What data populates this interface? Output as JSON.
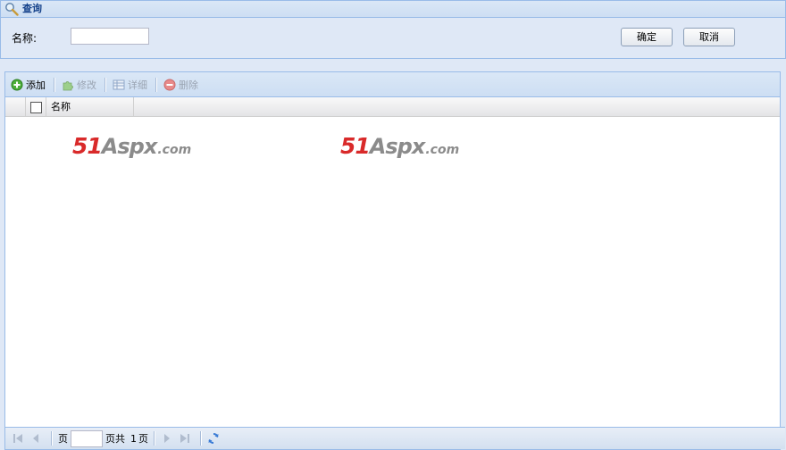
{
  "query_panel": {
    "title": "查询",
    "name_label": "名称:",
    "name_value": "",
    "confirm_label": "确定",
    "cancel_label": "取消"
  },
  "toolbar": {
    "add_label": "添加",
    "edit_label": "修改",
    "detail_label": "详细",
    "delete_label": "删除"
  },
  "grid": {
    "columns": [
      "名称"
    ],
    "rows": []
  },
  "watermark": {
    "number": "51",
    "brand": "Aspx",
    "suffix": ".com"
  },
  "pager": {
    "page_prefix": "页",
    "page_value": "",
    "total_text": "页共",
    "total_pages": "1",
    "page_suffix": "页"
  },
  "colors": {
    "panel_border": "#99bbe8",
    "panel_bg": "#dfe8f6",
    "header_text": "#15428b",
    "watermark_red": "#d92a2a",
    "watermark_gray": "#8b8b8b"
  }
}
